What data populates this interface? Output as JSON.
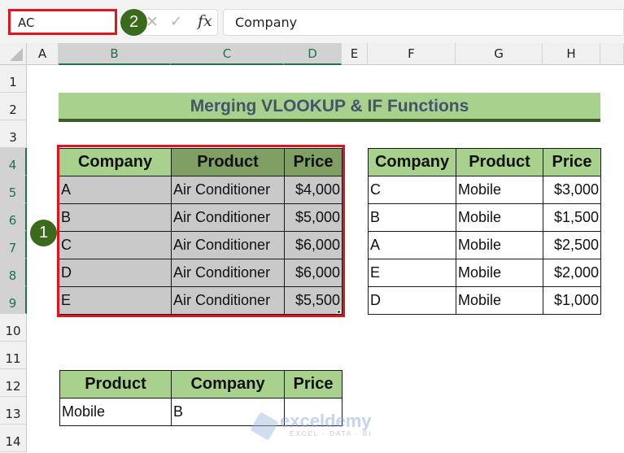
{
  "name_box": {
    "value": "AC"
  },
  "formula_bar": {
    "cancel_icon": "cancel-x-icon",
    "enter_icon": "check-icon",
    "fx_label": "fx",
    "value": "Company"
  },
  "badges": {
    "step1": "1",
    "step2": "2"
  },
  "columns": [
    "A",
    "B",
    "C",
    "D",
    "E",
    "F",
    "G",
    "H"
  ],
  "rows": [
    "1",
    "2",
    "3",
    "4",
    "5",
    "6",
    "7",
    "8",
    "9",
    "10",
    "11",
    "12",
    "13",
    "14"
  ],
  "title": "Merging VLOOKUP & IF Functions",
  "table1": {
    "headers": [
      "Company",
      "Product",
      "Price"
    ],
    "rows": [
      [
        "A",
        "Air Conditioner",
        "$4,000"
      ],
      [
        "B",
        "Air Conditioner",
        "$5,000"
      ],
      [
        "C",
        "Air Conditioner",
        "$6,000"
      ],
      [
        "D",
        "Air Conditioner",
        "$6,000"
      ],
      [
        "E",
        "Air Conditioner",
        "$5,500"
      ]
    ]
  },
  "table2": {
    "headers": [
      "Company",
      "Product",
      "Price"
    ],
    "rows": [
      [
        "C",
        "Mobile",
        "$3,000"
      ],
      [
        "B",
        "Mobile",
        "$1,500"
      ],
      [
        "A",
        "Mobile",
        "$2,500"
      ],
      [
        "E",
        "Mobile",
        "$2,000"
      ],
      [
        "D",
        "Mobile",
        "$1,000"
      ]
    ]
  },
  "table3": {
    "headers": [
      "Product",
      "Company",
      "Price"
    ],
    "rows": [
      [
        "Mobile",
        "B",
        ""
      ]
    ]
  },
  "watermark": {
    "brand": "exceldemy",
    "tagline": "EXCEL · DATA · BI"
  },
  "colors": {
    "selection_red": "#e0141e",
    "header_green": "#a9d18e",
    "header_dark_green": "#7f9f65",
    "excel_green": "#217346",
    "badge_green": "#3b6a1c",
    "title_text": "#44546a"
  }
}
